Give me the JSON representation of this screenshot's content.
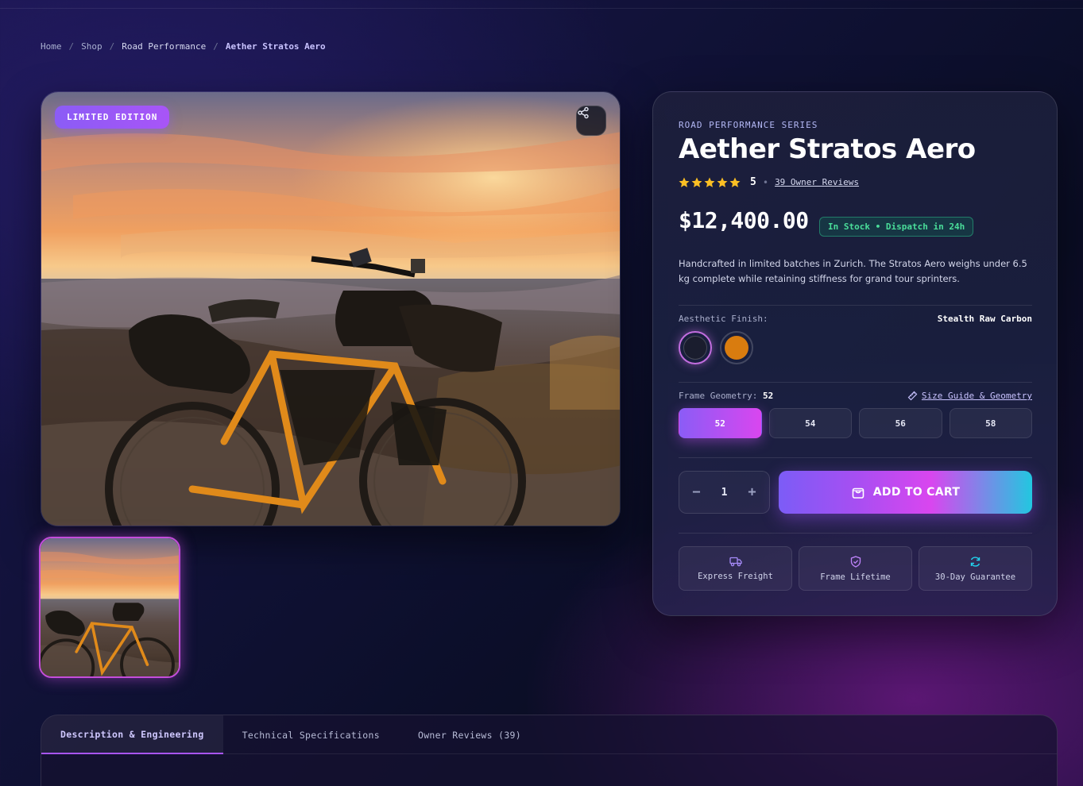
{
  "breadcrumb": {
    "items": [
      "Home",
      "Shop",
      "Road Performance"
    ],
    "current": "Aether Stratos Aero",
    "separator": "/"
  },
  "gallery": {
    "badge": "LIMITED EDITION",
    "share_icon": "share-icon",
    "thumbnail_selected": true
  },
  "product": {
    "series": "ROAD PERFORMANCE SERIES",
    "name": "Aether Stratos Aero",
    "rating": 5,
    "rating_label": "5",
    "reviews_link": "39 Owner Reviews",
    "price": "$12,400.00",
    "stock": "In Stock • Dispatch in 24h",
    "description": "Handcrafted in limited batches in Zurich. The Stratos Aero weighs under 6.5 kg complete while retaining stiffness for grand tour sprinters."
  },
  "finish": {
    "label": "Aesthetic Finish:",
    "selected": "Stealth Raw Carbon",
    "swatches": [
      {
        "name": "Stealth Raw Carbon",
        "color": "#1a1d2e",
        "selected": true
      },
      {
        "name": "Orange",
        "color": "#d97c0f",
        "selected": false
      }
    ]
  },
  "geometry": {
    "label": "Frame Geometry:",
    "selected": "52",
    "guide_link": "Size Guide & Geometry",
    "sizes": [
      "52",
      "54",
      "56",
      "58"
    ]
  },
  "purchase": {
    "quantity": "1",
    "minus": "−",
    "plus": "+",
    "add_to_cart": "ADD TO CART"
  },
  "perks": [
    {
      "label": "Express Freight",
      "icon": "truck-icon",
      "color": "#a78bfa"
    },
    {
      "label": "Frame Lifetime",
      "icon": "shield-icon",
      "color": "#c084fc"
    },
    {
      "label": "30-Day Guarantee",
      "icon": "refresh-icon",
      "color": "#22d3ee"
    }
  ],
  "tabs": [
    {
      "label": "Description & Engineering",
      "active": true
    },
    {
      "label": "Technical Specifications",
      "active": false
    },
    {
      "label": "Owner Reviews (39)",
      "active": false
    }
  ],
  "colors": {
    "accent_purple": "#8b5cf6",
    "accent_magenta": "#d946ef",
    "accent_cyan": "#22c7e0",
    "stock_green": "#4ade9a",
    "star_gold": "#fbbf24"
  }
}
